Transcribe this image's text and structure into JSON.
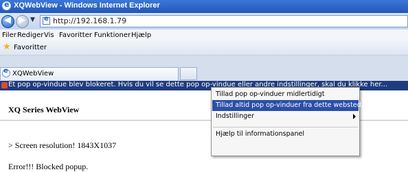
{
  "window": {
    "title": "XQWebView - Windows Internet Explorer"
  },
  "address": {
    "url": "http://192.168.1.79"
  },
  "menubar": {
    "items": [
      "Filer",
      "Rediger",
      "Vis",
      "Favoritter",
      "Funktioner",
      "Hjælp"
    ]
  },
  "favorites": {
    "label": "Favoritter"
  },
  "tab": {
    "label": "XQWebView"
  },
  "infobar": {
    "text": "Et pop op-vindue blev blokeret. Hvis du vil se dette pop op-vindue eller andre indstillinger, skal du klikke her..."
  },
  "context_menu": {
    "items": [
      "Tillad pop op-vinduer midlertidigt",
      "Tillad altid pop op-vinduer fra dette websted...",
      "Indstillinger",
      "Hjælp til informationspanel"
    ]
  },
  "page": {
    "title": "XQ Series WebView",
    "resolution": "> Screen resolution! 1843X1037",
    "error": "Error!!! Blocked popup."
  },
  "colors": {
    "titlebar": "#2a62c8",
    "infobar": "#1f3c7e",
    "highlight": "#2b4fa8"
  }
}
